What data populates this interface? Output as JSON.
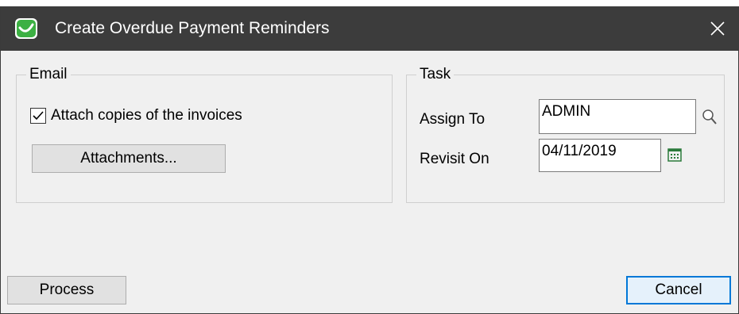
{
  "window": {
    "title": "Create Overdue Payment Reminders",
    "titlebar_color": "#3c3c3c",
    "icon": "app-logo-icon",
    "close_icon": "close-icon"
  },
  "email": {
    "legend": "Email",
    "attach_copies_label": "Attach copies of the invoices",
    "attach_copies_checked": true,
    "attachments_button": "Attachments..."
  },
  "task": {
    "legend": "Task",
    "assign_to_label": "Assign To",
    "assign_to_value": "ADMIN",
    "revisit_on_label": "Revisit On",
    "revisit_on_value": "04/11/2019",
    "lookup_icon": "magnifier-icon",
    "calendar_icon": "calendar-icon"
  },
  "footer": {
    "process_button": "Process",
    "cancel_button": "Cancel"
  },
  "colors": {
    "accent": "#0078d7",
    "brand_green": "#3cb043"
  }
}
